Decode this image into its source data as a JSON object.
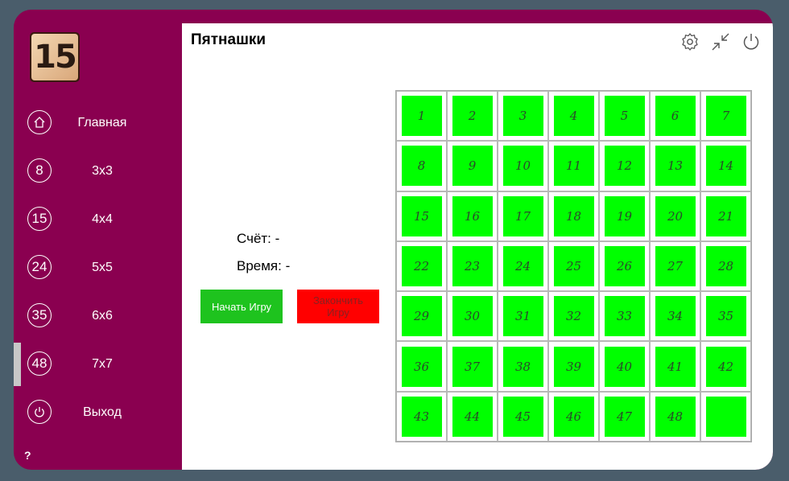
{
  "app": {
    "title": "Пятнашки",
    "logo_text": "15"
  },
  "sidebar": {
    "items": [
      {
        "icon": "home-icon",
        "badge": "",
        "label": "Главная"
      },
      {
        "icon": "size-3-icon",
        "badge": "8",
        "label": "3x3"
      },
      {
        "icon": "size-4-icon",
        "badge": "15",
        "label": "4x4"
      },
      {
        "icon": "size-5-icon",
        "badge": "24",
        "label": "5x5"
      },
      {
        "icon": "size-6-icon",
        "badge": "35",
        "label": "6x6"
      },
      {
        "icon": "size-7-icon",
        "badge": "48",
        "label": "7x7",
        "active": true
      },
      {
        "icon": "power-icon",
        "badge": "",
        "label": "Выход"
      }
    ],
    "help": "?"
  },
  "game": {
    "score": "Счёт: -",
    "time": "Время: -",
    "start_label": "Начать Игру",
    "end_label": "Закончить Игру",
    "board": [
      "1",
      "2",
      "3",
      "4",
      "5",
      "6",
      "7",
      "8",
      "9",
      "10",
      "11",
      "12",
      "13",
      "14",
      "15",
      "16",
      "17",
      "18",
      "19",
      "20",
      "21",
      "22",
      "23",
      "24",
      "25",
      "26",
      "27",
      "28",
      "29",
      "30",
      "31",
      "32",
      "33",
      "34",
      "35",
      "36",
      "37",
      "38",
      "39",
      "40",
      "41",
      "42",
      "43",
      "44",
      "45",
      "46",
      "47",
      "48",
      ""
    ]
  },
  "colors": {
    "sidebar": "#8a0050",
    "tile": "#00ff00",
    "start": "#1ec31e",
    "end": "#ff0000"
  }
}
